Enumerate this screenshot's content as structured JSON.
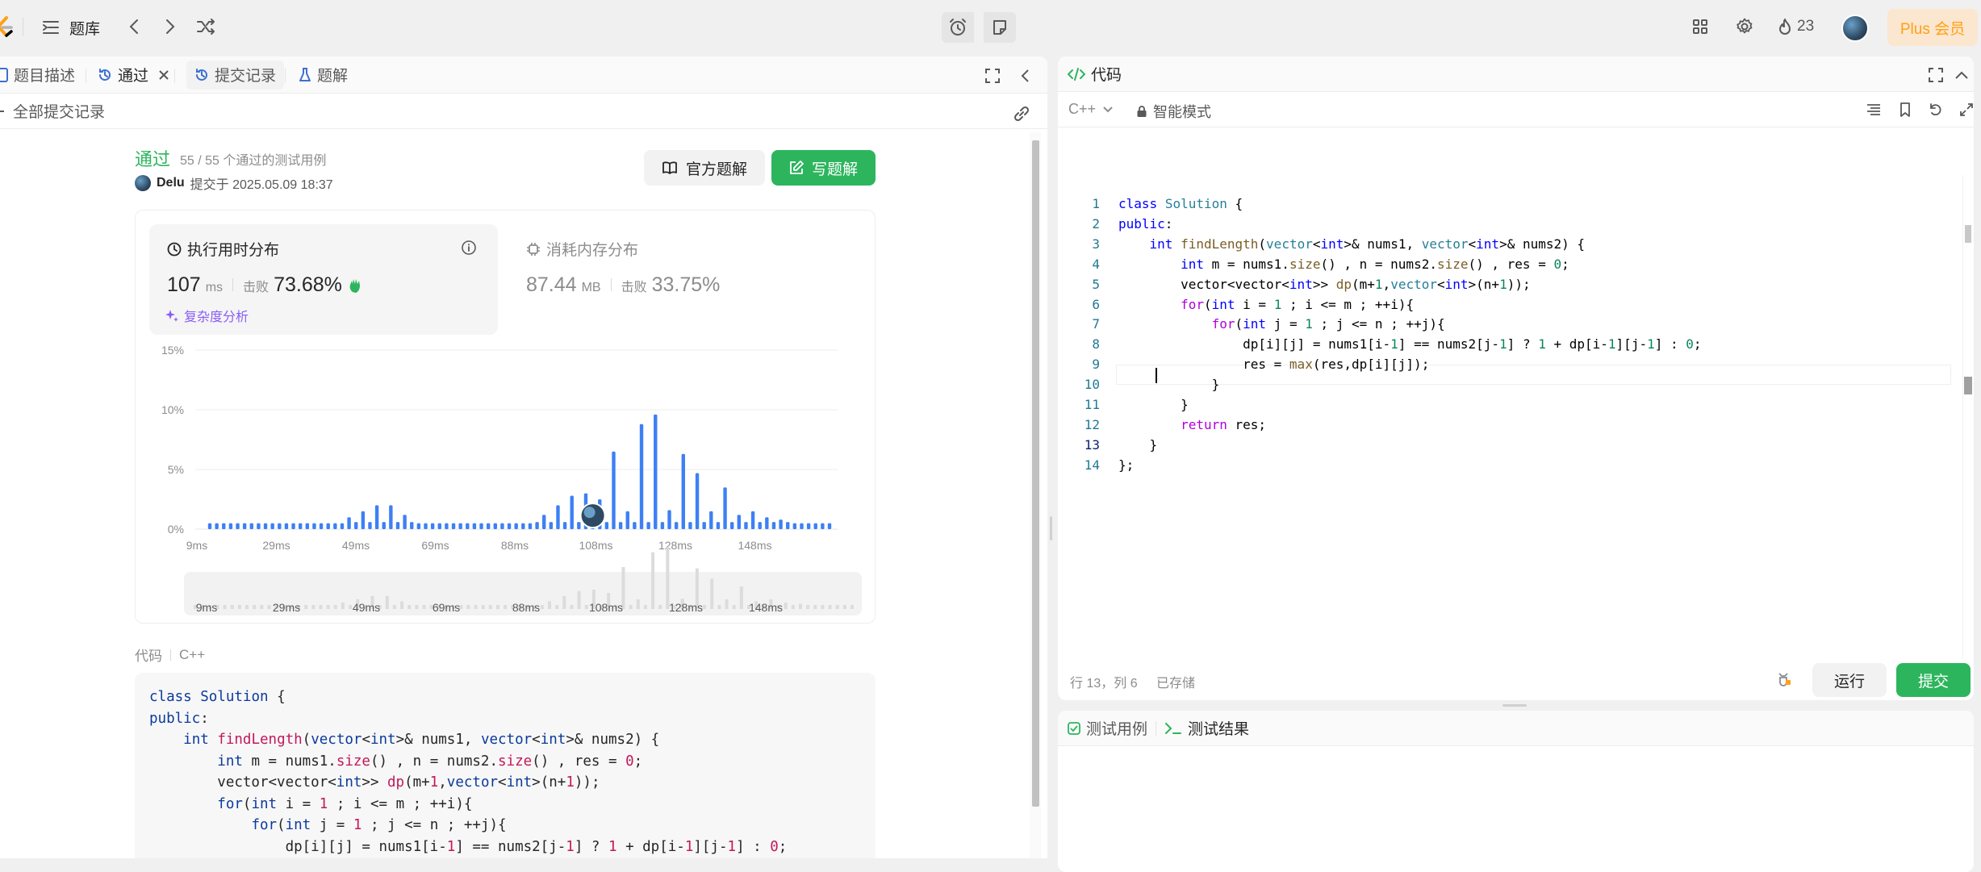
{
  "topbar": {
    "title": "题库",
    "streak": "23",
    "plus": "Plus 会员"
  },
  "left": {
    "tabs": [
      {
        "label": "题目描述"
      },
      {
        "label": "通过"
      },
      {
        "label": "提交记录"
      },
      {
        "label": "题解"
      }
    ],
    "back_label": "全部提交记录",
    "status": "通过",
    "tests": "55 / 55 个通过的测试用例",
    "user": "Delu",
    "submitted": "提交于 2025.05.09 18:37",
    "official_btn": "官方题解",
    "write_btn": "写题解",
    "runtime": {
      "title": "执行用时分布",
      "value": "107",
      "unit": "ms",
      "beats_label": "击败",
      "beats": "73.68%",
      "complexity": "复杂度分析"
    },
    "memory": {
      "title": "消耗内存分布",
      "value": "87.44",
      "unit": "MB",
      "beats_label": "击败",
      "beats": "33.75%"
    },
    "code_label": "代码",
    "code_lang": "C++"
  },
  "chart_data": {
    "type": "bar",
    "x_tick_labels": [
      "9ms",
      "29ms",
      "49ms",
      "69ms",
      "88ms",
      "108ms",
      "128ms",
      "148ms"
    ],
    "y_tick_labels": [
      "0%",
      "5%",
      "10%",
      "15%"
    ],
    "ylim": [
      0,
      15
    ],
    "values": [
      0.5,
      0.5,
      0.5,
      0.5,
      0.5,
      0.5,
      0.5,
      0.5,
      0.5,
      0.5,
      0.5,
      0.5,
      0.5,
      0.5,
      0.5,
      0.5,
      0.5,
      0.5,
      0.5,
      0.5,
      1,
      0.6,
      1.5,
      0.6,
      2,
      0.6,
      2,
      0.6,
      1.2,
      0.6,
      0.5,
      0.5,
      0.5,
      0.5,
      0.5,
      0.5,
      0.5,
      0.5,
      0.5,
      0.5,
      0.5,
      0.5,
      0.5,
      0.5,
      0.5,
      0.5,
      0.5,
      0.6,
      1.2,
      0.6,
      2,
      0.6,
      2.8,
      0.6,
      3,
      0.6,
      2.5,
      0.6,
      6.5,
      0.6,
      1.5,
      0.6,
      8.8,
      0.6,
      9.6,
      0.6,
      1.6,
      0.6,
      6.3,
      0.6,
      4.7,
      0.6,
      1.5,
      0.6,
      3.5,
      0.6,
      1.2,
      0.6,
      1.5,
      0.6,
      1,
      0.6,
      0.8,
      0.6,
      0.5,
      0.5,
      0.5,
      0.5,
      0.5,
      0.5
    ],
    "highlight_index": 55
  },
  "editor": {
    "title": "代码",
    "lang": "C++",
    "mode": "智能模式",
    "status_pos": "行 13，列 6",
    "status_saved": "已存储",
    "run": "运行",
    "submit": "提交"
  },
  "bottom_tabs": [
    {
      "label": "测试用例"
    },
    {
      "label": "测试结果"
    }
  ],
  "code_lines": [
    "<span class=\"kw\">class</span> <span class=\"ty\">Solution</span> {",
    "<span class=\"kw\">public</span>:",
    "    <span class=\"kw\">int</span> <span class=\"fn\">findLength</span>(<span class=\"ty\">vector</span>&lt;<span class=\"kw\">int</span>&gt;&amp; nums1, <span class=\"ty\">vector</span>&lt;<span class=\"kw\">int</span>&gt;&amp; nums2) {",
    "        <span class=\"kw\">int</span> m = nums1.<span class=\"fn\">size</span>() , n = nums2.<span class=\"fn\">size</span>() , res = <span class=\"nm\">0</span>;",
    "        vector&lt;vector&lt;<span class=\"kw\">int</span>&gt;&gt; <span class=\"fn\">dp</span>(m+<span class=\"nm\">1</span>,<span class=\"ty\">vector</span>&lt;<span class=\"kw\">int</span>&gt;(n+<span class=\"nm\">1</span>));",
    "        <span class=\"kw2\">for</span>(<span class=\"kw\">int</span> i = <span class=\"nm\">1</span> ; i &lt;= m ; ++i){",
    "            <span class=\"kw2\">for</span>(<span class=\"kw\">int</span> j = <span class=\"nm\">1</span> ; j &lt;= n ; ++j){",
    "                dp[i][j] = nums1[i-<span class=\"nm\">1</span>] == nums2[j-<span class=\"nm\">1</span>] ? <span class=\"nm\">1</span> + dp[i-<span class=\"nm\">1</span>][j-<span class=\"nm\">1</span>] : <span class=\"nm\">0</span>;",
    "                res = <span class=\"fn\">max</span>(res,dp[i][j]);",
    "            }",
    "        }",
    "        <span class=\"kw2\">return</span> res;",
    "    }",
    "};"
  ]
}
